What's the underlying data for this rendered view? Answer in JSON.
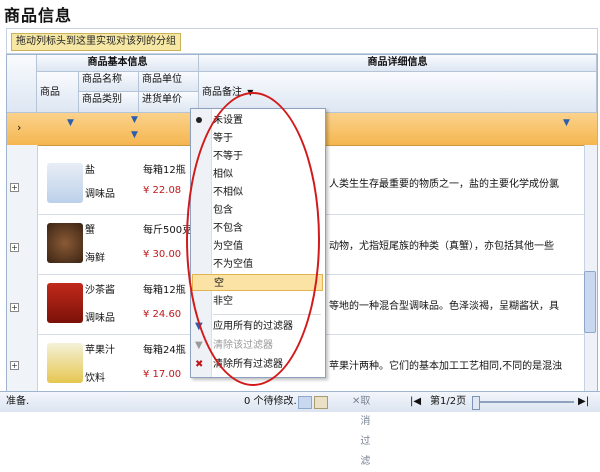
{
  "page": {
    "title": "商品信息"
  },
  "group_panel": {
    "hint": "拖动列标头到这里实现对该列的分组"
  },
  "headers": {
    "band_basic": "商品基本信息",
    "band_detail": "商品详细信息",
    "col_product": "商品",
    "col_name": "商品名称",
    "col_category": "商品类别",
    "col_unit": "商品单位",
    "col_purchase_price": "进货单价",
    "col_remark": "商品备注"
  },
  "rows": [
    {
      "name": "盐",
      "category": "调味品",
      "unit": "每箱12瓶",
      "price": "¥ 22.08",
      "remark": "人类生生存最重要的物质之一，盐的主要化学成份氯"
    },
    {
      "name": "蟹",
      "category": "海鲜",
      "unit": "每斤500克",
      "price": "¥ 30.00",
      "remark": "动物，尤指短尾族的种类（真蟹），亦包括其他一些"
    },
    {
      "name": "沙茶酱",
      "category": "调味品",
      "unit": "每箱12瓶",
      "price": "¥ 24.60",
      "remark": "等地的一种混合型调味品。色泽淡褐，呈糊酱状，具"
    },
    {
      "name": "苹果汁",
      "category": "饮料",
      "unit": "每箱24瓶",
      "price": "¥ 17.00",
      "remark": "苹果汁两种。它们的基本加工工艺相同,不同的是混浊"
    }
  ],
  "filter_menu": {
    "items": [
      {
        "label": "未设置",
        "selected": true
      },
      {
        "label": "等于"
      },
      {
        "label": "不等于"
      },
      {
        "label": "相似"
      },
      {
        "label": "不相似"
      },
      {
        "label": "包含"
      },
      {
        "label": "不包含"
      },
      {
        "label": "为空值"
      },
      {
        "label": "不为空值"
      },
      {
        "label": "空",
        "highlighted": true
      },
      {
        "label": "非空"
      }
    ],
    "apply_all": "应用所有的过滤器",
    "clear_this": "清除该过滤器",
    "clear_all": "清除所有过滤器"
  },
  "status": {
    "ready": "准备.",
    "pending": "0 个待修改.",
    "cancel_filter": "取消过滤",
    "page": "第1/2页"
  },
  "colors": {
    "header_band": "#dde6f2",
    "filter_row": "#f5b650",
    "highlight": "#fbe3a6",
    "price": "#c0181b",
    "annotation": "#d21a1a"
  }
}
